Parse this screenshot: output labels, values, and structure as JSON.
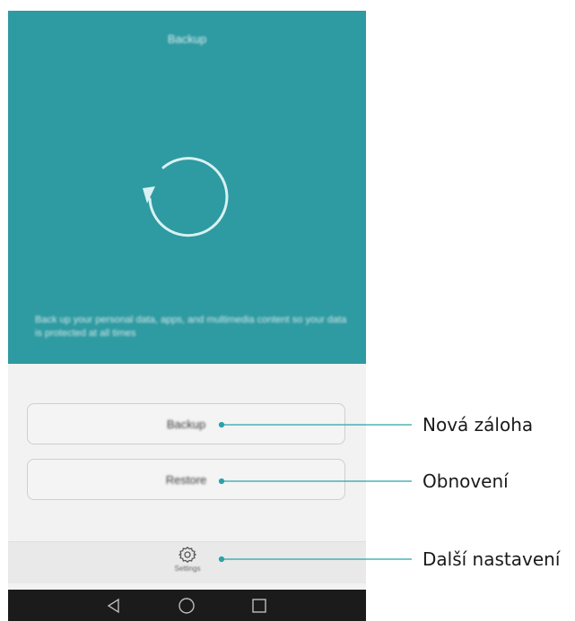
{
  "screen": {
    "title": "Backup",
    "description": "Back up your personal data, apps, and multimedia content so your data is protected at all times",
    "backup_button": "Backup",
    "restore_button": "Restore",
    "settings_label": "Settings"
  },
  "callouts": {
    "backup": "Nová záloha",
    "restore": "Obnovení",
    "settings": "Další nastavení"
  },
  "colors": {
    "accent": "#2e9aa1",
    "background": "#f2f2f2",
    "nav_bar": "#1b1b1b"
  },
  "icons": {
    "hero": "circular-arrow-icon",
    "settings": "gear-icon",
    "nav_back": "triangle-back-icon",
    "nav_home": "circle-home-icon",
    "nav_recent": "square-recent-icon"
  }
}
